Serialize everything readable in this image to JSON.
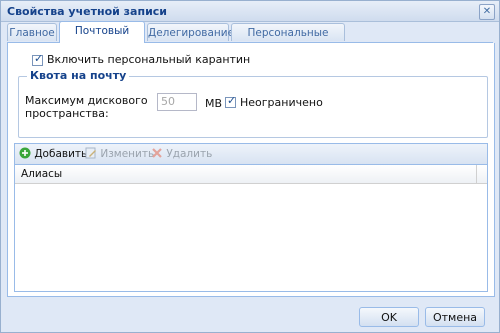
{
  "window": {
    "title": "Свойства учетной записи"
  },
  "tabs": [
    {
      "label": "Главное",
      "active": false
    },
    {
      "label": "Почтовый ящик",
      "active": true
    },
    {
      "label": "Делегирование",
      "active": false
    },
    {
      "label": "Персональные данные",
      "active": false
    }
  ],
  "quarantine": {
    "label": "Включить персональный карантин",
    "checked": true
  },
  "quota": {
    "legend": "Квота на почту",
    "max_label_line1": "Максимум дискового",
    "max_label_line2": "пространства:",
    "value": "50",
    "unit": "MB",
    "unlimited_label": "Неограничено",
    "unlimited_checked": true
  },
  "aliases": {
    "toolbar": {
      "add_label": "Добавить",
      "edit_label": "Изменить",
      "delete_label": "Удалить"
    },
    "column_header": "Алиасы",
    "rows": []
  },
  "footer": {
    "ok_label": "OK",
    "cancel_label": "Отмена"
  },
  "colors": {
    "accent": "#15428b",
    "border": "#99bbe8",
    "window_bg": "#dfe8f6"
  }
}
